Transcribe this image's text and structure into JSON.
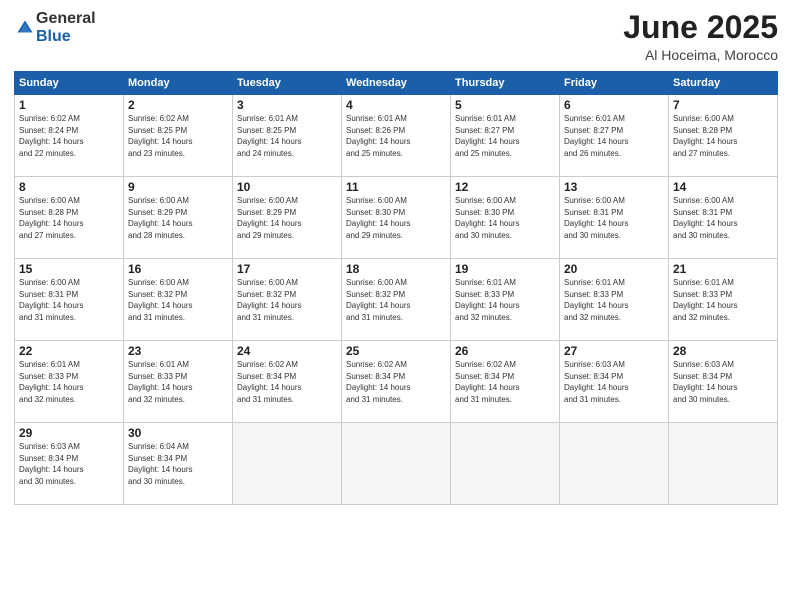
{
  "logo": {
    "general": "General",
    "blue": "Blue"
  },
  "title": "June 2025",
  "location": "Al Hoceima, Morocco",
  "headers": [
    "Sunday",
    "Monday",
    "Tuesday",
    "Wednesday",
    "Thursday",
    "Friday",
    "Saturday"
  ],
  "weeks": [
    [
      {
        "day": "1",
        "info": "Sunrise: 6:02 AM\nSunset: 8:24 PM\nDaylight: 14 hours\nand 22 minutes."
      },
      {
        "day": "2",
        "info": "Sunrise: 6:02 AM\nSunset: 8:25 PM\nDaylight: 14 hours\nand 23 minutes."
      },
      {
        "day": "3",
        "info": "Sunrise: 6:01 AM\nSunset: 8:25 PM\nDaylight: 14 hours\nand 24 minutes."
      },
      {
        "day": "4",
        "info": "Sunrise: 6:01 AM\nSunset: 8:26 PM\nDaylight: 14 hours\nand 25 minutes."
      },
      {
        "day": "5",
        "info": "Sunrise: 6:01 AM\nSunset: 8:27 PM\nDaylight: 14 hours\nand 25 minutes."
      },
      {
        "day": "6",
        "info": "Sunrise: 6:01 AM\nSunset: 8:27 PM\nDaylight: 14 hours\nand 26 minutes."
      },
      {
        "day": "7",
        "info": "Sunrise: 6:00 AM\nSunset: 8:28 PM\nDaylight: 14 hours\nand 27 minutes."
      }
    ],
    [
      {
        "day": "8",
        "info": "Sunrise: 6:00 AM\nSunset: 8:28 PM\nDaylight: 14 hours\nand 27 minutes."
      },
      {
        "day": "9",
        "info": "Sunrise: 6:00 AM\nSunset: 8:29 PM\nDaylight: 14 hours\nand 28 minutes."
      },
      {
        "day": "10",
        "info": "Sunrise: 6:00 AM\nSunset: 8:29 PM\nDaylight: 14 hours\nand 29 minutes."
      },
      {
        "day": "11",
        "info": "Sunrise: 6:00 AM\nSunset: 8:30 PM\nDaylight: 14 hours\nand 29 minutes."
      },
      {
        "day": "12",
        "info": "Sunrise: 6:00 AM\nSunset: 8:30 PM\nDaylight: 14 hours\nand 30 minutes."
      },
      {
        "day": "13",
        "info": "Sunrise: 6:00 AM\nSunset: 8:31 PM\nDaylight: 14 hours\nand 30 minutes."
      },
      {
        "day": "14",
        "info": "Sunrise: 6:00 AM\nSunset: 8:31 PM\nDaylight: 14 hours\nand 30 minutes."
      }
    ],
    [
      {
        "day": "15",
        "info": "Sunrise: 6:00 AM\nSunset: 8:31 PM\nDaylight: 14 hours\nand 31 minutes."
      },
      {
        "day": "16",
        "info": "Sunrise: 6:00 AM\nSunset: 8:32 PM\nDaylight: 14 hours\nand 31 minutes."
      },
      {
        "day": "17",
        "info": "Sunrise: 6:00 AM\nSunset: 8:32 PM\nDaylight: 14 hours\nand 31 minutes."
      },
      {
        "day": "18",
        "info": "Sunrise: 6:00 AM\nSunset: 8:32 PM\nDaylight: 14 hours\nand 31 minutes."
      },
      {
        "day": "19",
        "info": "Sunrise: 6:01 AM\nSunset: 8:33 PM\nDaylight: 14 hours\nand 32 minutes."
      },
      {
        "day": "20",
        "info": "Sunrise: 6:01 AM\nSunset: 8:33 PM\nDaylight: 14 hours\nand 32 minutes."
      },
      {
        "day": "21",
        "info": "Sunrise: 6:01 AM\nSunset: 8:33 PM\nDaylight: 14 hours\nand 32 minutes."
      }
    ],
    [
      {
        "day": "22",
        "info": "Sunrise: 6:01 AM\nSunset: 8:33 PM\nDaylight: 14 hours\nand 32 minutes."
      },
      {
        "day": "23",
        "info": "Sunrise: 6:01 AM\nSunset: 8:33 PM\nDaylight: 14 hours\nand 32 minutes."
      },
      {
        "day": "24",
        "info": "Sunrise: 6:02 AM\nSunset: 8:34 PM\nDaylight: 14 hours\nand 31 minutes."
      },
      {
        "day": "25",
        "info": "Sunrise: 6:02 AM\nSunset: 8:34 PM\nDaylight: 14 hours\nand 31 minutes."
      },
      {
        "day": "26",
        "info": "Sunrise: 6:02 AM\nSunset: 8:34 PM\nDaylight: 14 hours\nand 31 minutes."
      },
      {
        "day": "27",
        "info": "Sunrise: 6:03 AM\nSunset: 8:34 PM\nDaylight: 14 hours\nand 31 minutes."
      },
      {
        "day": "28",
        "info": "Sunrise: 6:03 AM\nSunset: 8:34 PM\nDaylight: 14 hours\nand 30 minutes."
      }
    ],
    [
      {
        "day": "29",
        "info": "Sunrise: 6:03 AM\nSunset: 8:34 PM\nDaylight: 14 hours\nand 30 minutes."
      },
      {
        "day": "30",
        "info": "Sunrise: 6:04 AM\nSunset: 8:34 PM\nDaylight: 14 hours\nand 30 minutes."
      },
      {
        "day": "",
        "info": ""
      },
      {
        "day": "",
        "info": ""
      },
      {
        "day": "",
        "info": ""
      },
      {
        "day": "",
        "info": ""
      },
      {
        "day": "",
        "info": ""
      }
    ]
  ]
}
